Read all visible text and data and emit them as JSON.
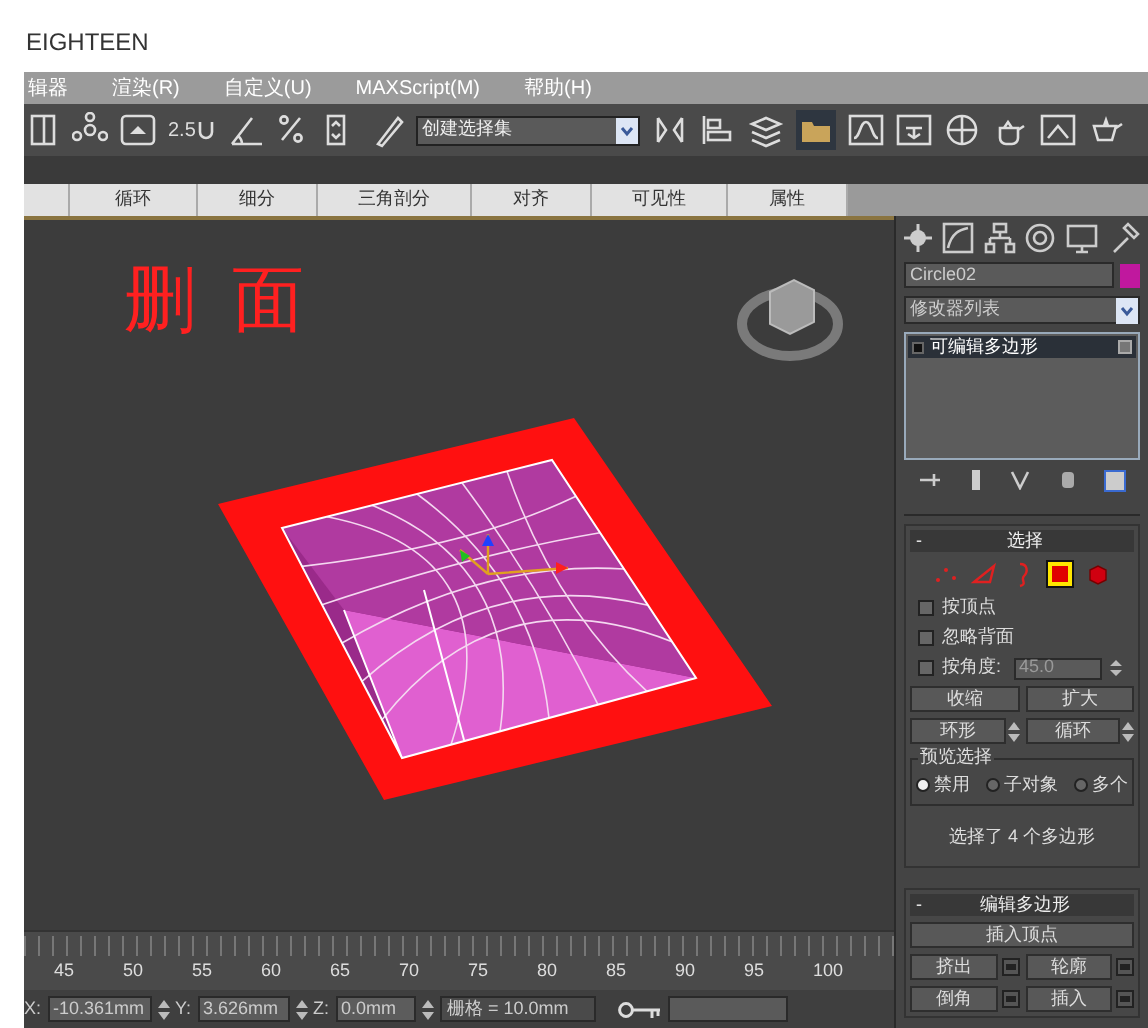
{
  "page_heading": "EIGHTEEN",
  "menu": [
    "辑器",
    "渲染(R)",
    "自定义(U)",
    "MAXScript(M)",
    "帮助(H)"
  ],
  "toolbar": {
    "snap_label": "2.5",
    "selection_set": "创建选择集"
  },
  "ribbon_tabs": [
    "循环",
    "细分",
    "三角剖分",
    "对齐",
    "可见性",
    "属性"
  ],
  "viewport": {
    "annotation": "删面"
  },
  "command_panel": {
    "object_name": "Circle02",
    "modifier_list": "修改器列表",
    "stack": [
      {
        "label": "可编辑多边形",
        "selected": true
      }
    ],
    "selection_rollout": {
      "toggle": "-",
      "title": "选择",
      "subobjects": [
        {
          "kind": "vertex",
          "selected": false
        },
        {
          "kind": "edge",
          "selected": false
        },
        {
          "kind": "border",
          "selected": false
        },
        {
          "kind": "polygon",
          "selected": true
        },
        {
          "kind": "element",
          "selected": false
        }
      ],
      "options": [
        {
          "label": "按顶点",
          "checked": false
        },
        {
          "label": "忽略背面",
          "checked": false
        },
        {
          "label": "按角度:",
          "checked": false,
          "value": "45.0"
        }
      ],
      "buttons": [
        "收缩",
        "扩大"
      ],
      "spinner_buttons": [
        "环形",
        "循环"
      ],
      "preview": {
        "title": "预览选择",
        "options": [
          {
            "label": "禁用",
            "selected": true
          },
          {
            "label": "子对象",
            "selected": false
          },
          {
            "label": "多个",
            "selected": false
          }
        ]
      },
      "status": "选择了 4 个多边形"
    },
    "edit_rollout": {
      "toggle": "-",
      "title": "编辑多边形",
      "buttons": [
        "插入顶点"
      ],
      "settings_buttons": [
        "挤出",
        "轮廓",
        "倒角",
        "插入"
      ]
    }
  },
  "timeline": {
    "ticks": [
      "45",
      "50",
      "55",
      "60",
      "65",
      "70",
      "75",
      "80",
      "85",
      "90",
      "95",
      "100"
    ]
  },
  "coordinates": {
    "x_label": "X:",
    "x": "-10.361mm",
    "y_label": "Y:",
    "y": "3.626mm",
    "z_label": "Z:",
    "z": "0.0mm",
    "grid": "栅格 = 10.0mm"
  }
}
